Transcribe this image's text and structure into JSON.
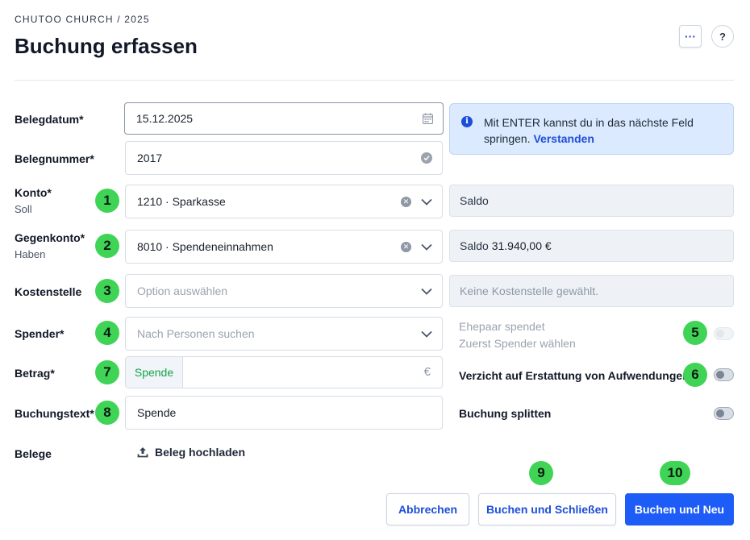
{
  "header": {
    "breadcrumb": "CHUTOO CHURCH / 2025",
    "title": "Buchung erfassen",
    "more_label": "···",
    "help_label": "?"
  },
  "form": {
    "belegdatum": {
      "label": "Belegdatum*",
      "value": "15.12.2025",
      "icon": "calendar-icon"
    },
    "belegnummer": {
      "label": "Belegnummer*",
      "value": "2017",
      "icon": "check-circle-icon"
    },
    "konto": {
      "label": "Konto*",
      "sublabel": "Soll",
      "value": "1210 · Sparkasse",
      "badge": "1"
    },
    "gegenkonto": {
      "label": "Gegenkonto*",
      "sublabel": "Haben",
      "value": "8010 · Spendeneinnahmen",
      "badge": "2"
    },
    "kostenstelle": {
      "label": "Kostenstelle",
      "placeholder": "Option auswählen",
      "badge": "3"
    },
    "spender": {
      "label": "Spender*",
      "placeholder": "Nach Personen suchen",
      "badge": "4"
    },
    "betrag": {
      "label": "Betrag*",
      "prefix": "Spende",
      "value": "",
      "currency": "€",
      "badge": "7"
    },
    "buchungstext": {
      "label": "Buchungstext*",
      "value": "Spende",
      "badge": "8"
    },
    "belege": {
      "label": "Belege",
      "upload_label": "Beleg hochladen"
    }
  },
  "info": {
    "text": "Mit ENTER kannst du in das nächste Feld springen. ",
    "link": "Verstanden"
  },
  "side": {
    "konto_saldo": "Saldo",
    "gegenkonto_saldo_label": "Saldo",
    "gegenkonto_saldo_value": "31.940,00 €",
    "kostenstelle_info": "Keine Kostenstelle gewählt."
  },
  "toggles": {
    "ehepaar": {
      "label": "Ehepaar spendet",
      "sublabel": "Zuerst Spender wählen",
      "badge": "5",
      "on": false,
      "disabled": true
    },
    "verzicht": {
      "label": "Verzicht auf Erstattung von Aufwendungen",
      "badge": "6",
      "on": false
    },
    "splitten": {
      "label": "Buchung splitten",
      "on": false
    }
  },
  "actions": {
    "cancel": "Abbrechen",
    "save_close": "Buchen und Schließen",
    "save_close_badge": "9",
    "save_new": "Buchen und Neu",
    "save_new_badge": "10"
  },
  "colors": {
    "primary": "#1d5cf6",
    "badge": "#3fd456",
    "info_bg": "#dbeafe",
    "prefix_text": "#16a34a"
  }
}
